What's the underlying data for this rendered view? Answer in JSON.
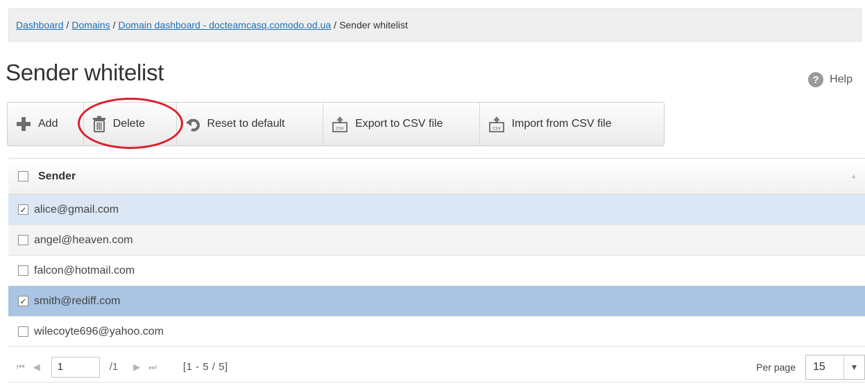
{
  "breadcrumb": {
    "items": [
      "Dashboard",
      "Domains",
      "Domain dashboard - docteamcasq.comodo.od.ua"
    ],
    "separator": "/",
    "current": "Sender whitelist"
  },
  "page": {
    "title": "Sender whitelist",
    "help_label": "Help",
    "help_icon_glyph": "?"
  },
  "toolbar": {
    "add_label": "Add",
    "delete_label": "Delete",
    "reset_label": "Reset to default",
    "export_label": "Export to CSV file",
    "import_label": "Import from CSV file"
  },
  "table": {
    "column_header": "Sender",
    "rows": [
      {
        "email": "alice@gmail.com",
        "checked": true
      },
      {
        "email": "angel@heaven.com",
        "checked": false
      },
      {
        "email": "falcon@hotmail.com",
        "checked": false
      },
      {
        "email": "smith@rediff.com",
        "checked": true
      },
      {
        "email": "wilecoyte696@yahoo.com",
        "checked": false
      }
    ],
    "checked_mark": "✓"
  },
  "pager": {
    "page_value": "1",
    "total_pages": "/1",
    "range": "[1 - 5 / 5]",
    "per_page_label": "Per page",
    "per_page_value": "15"
  },
  "colors": {
    "link": "#1f6fb5",
    "selected_row_light": "#dbe7f5",
    "selected_row_dark": "#aac4e3",
    "highlight_ring": "#d8202a",
    "add_icon": "#6e6e6e"
  }
}
